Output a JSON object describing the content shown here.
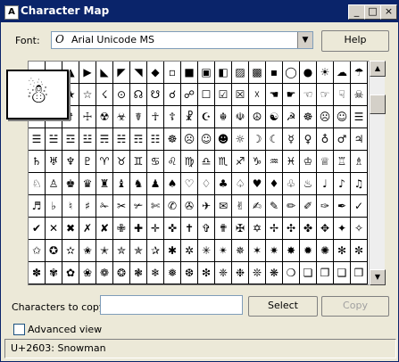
{
  "window": {
    "title": "Character Map",
    "icon": "character-map-app-icon"
  },
  "title_buttons": [
    "_",
    "□",
    "×"
  ],
  "font": {
    "label": "Font:",
    "value": "Arial Unicode MS",
    "glyph": "O"
  },
  "help_label": "Help",
  "grid_rows": [
    [
      "",
      "",
      "▲",
      "▶",
      "◣",
      "◤",
      "◥",
      "◆",
      "▫",
      "■",
      "▣",
      "◧",
      "▨",
      "▩",
      "▪",
      "◯",
      "●",
      "☀",
      "☁",
      "☂"
    ],
    [
      "",
      "",
      "★",
      "☆",
      "☇",
      "⊙",
      "☊",
      "☋",
      "☌",
      "☍",
      "☐",
      "☑",
      "☒",
      "☓",
      "☚",
      "☛",
      "☜",
      "☞",
      "☟",
      "☠"
    ],
    [
      "",
      "",
      "☨",
      "☩",
      "☢",
      "☣",
      "☤",
      "☥",
      "☦",
      "☧",
      "☪",
      "☬",
      "☫",
      "☮",
      "☯",
      "☭",
      "☸",
      "☹",
      "☺",
      "☰"
    ],
    [
      "☰",
      "☱",
      "☲",
      "☳",
      "☴",
      "☵",
      "☶",
      "☷",
      "☸",
      "☹",
      "☺",
      "☻",
      "☼",
      "☽",
      "☾",
      "☿",
      "♀",
      "♁",
      "♂",
      "♃"
    ],
    [
      "♄",
      "♅",
      "♆",
      "♇",
      "♈",
      "♉",
      "♊",
      "♋",
      "♌",
      "♍",
      "♎",
      "♏",
      "♐",
      "♑",
      "♒",
      "♓",
      "♔",
      "♕",
      "♖",
      "♗"
    ],
    [
      "♘",
      "♙",
      "♚",
      "♛",
      "♜",
      "♝",
      "♞",
      "♟",
      "♠",
      "♡",
      "♢",
      "♣",
      "♤",
      "♥",
      "♦",
      "♧",
      "♨",
      "♩",
      "♪",
      "♫"
    ],
    [
      "♬",
      "♭",
      "♮",
      "♯",
      "✁",
      "✂",
      "✃",
      "✄",
      "✆",
      "✇",
      "✈",
      "✉",
      "✌",
      "✍",
      "✎",
      "✏",
      "✐",
      "✑",
      "✒",
      "✓"
    ],
    [
      "✔",
      "✕",
      "✖",
      "✗",
      "✘",
      "✙",
      "✚",
      "✛",
      "✜",
      "✝",
      "✞",
      "✟",
      "✠",
      "✡",
      "✢",
      "✣",
      "✤",
      "✥",
      "✦",
      "✧"
    ],
    [
      "✩",
      "✪",
      "✫",
      "✬",
      "✭",
      "✮",
      "✯",
      "✰",
      "✱",
      "✲",
      "✳",
      "✴",
      "✵",
      "✶",
      "✷",
      "✸",
      "✹",
      "✺",
      "✻",
      "✼"
    ],
    [
      "✽",
      "✾",
      "✿",
      "❀",
      "❁",
      "❂",
      "❃",
      "❄",
      "❅",
      "❆",
      "❇",
      "❈",
      "❉",
      "❊",
      "❋",
      "❍",
      "❏",
      "❐",
      "❑",
      "❒"
    ]
  ],
  "preview_char": "☃",
  "copy": {
    "label": "Characters to copy:",
    "value": ""
  },
  "select_label": "Select",
  "copy_btn_label": "Copy",
  "advanced_view": {
    "label": "Advanced view",
    "checked": false
  },
  "status": "U+2603: Snowman",
  "colors": {
    "titlebar": "#0a246a",
    "face": "#ece9d8"
  }
}
